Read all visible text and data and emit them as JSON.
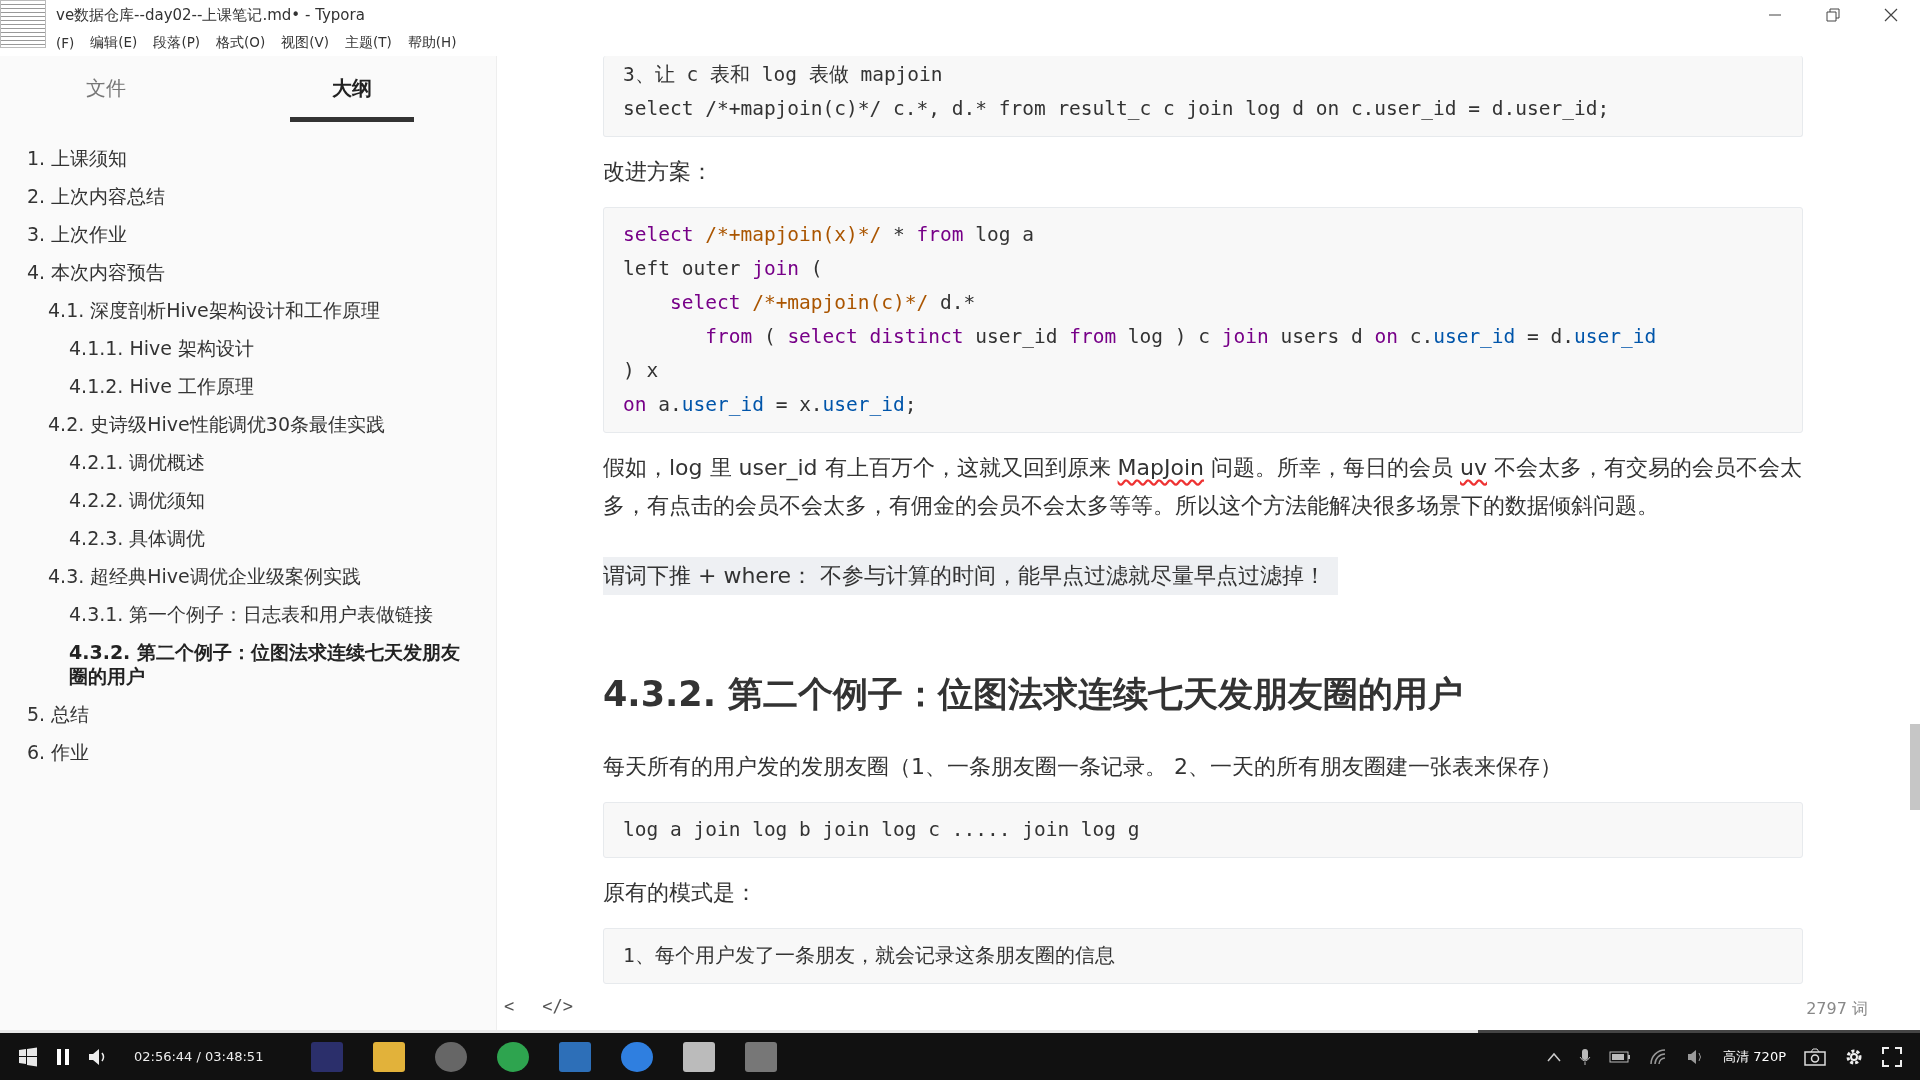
{
  "title_bar": {
    "title": "ve数据仓库--day02--上课笔记.md• - Typora"
  },
  "menu": [
    {
      "label": "(F)"
    },
    {
      "label": "编辑(E)"
    },
    {
      "label": "段落(P)"
    },
    {
      "label": "格式(O)"
    },
    {
      "label": "视图(V)"
    },
    {
      "label": "主题(T)"
    },
    {
      "label": "帮助(H)"
    }
  ],
  "sidebar": {
    "tabs": [
      {
        "label": "文件",
        "selected": false
      },
      {
        "label": "大纲",
        "selected": true
      }
    ],
    "outline": [
      {
        "label": "1. 上课须知",
        "selected": false
      },
      {
        "label": "2. 上次内容总结",
        "selected": false
      },
      {
        "label": "3. 上次作业",
        "selected": false
      },
      {
        "label": "4. 本次内容预告",
        "selected": false,
        "children": [
          {
            "label": "4.1. 深度剖析Hive架构设计和工作原理",
            "selected": false,
            "children": [
              {
                "label": "4.1.1. Hive 架构设计",
                "selected": false
              },
              {
                "label": "4.1.2. Hive 工作原理",
                "selected": false
              }
            ]
          },
          {
            "label": "4.2. 史诗级Hive性能调优30条最佳实践",
            "selected": false,
            "children": [
              {
                "label": "4.2.1. 调优概述",
                "selected": false
              },
              {
                "label": "4.2.2. 调优须知",
                "selected": false
              },
              {
                "label": "4.2.3. 具体调优",
                "selected": false
              }
            ]
          },
          {
            "label": "4.3. 超经典Hive调优企业级案例实践",
            "selected": false,
            "children": [
              {
                "label": "4.3.1. 第一个例子：日志表和用户表做链接",
                "selected": false
              },
              {
                "label": "4.3.2. 第二个例子：位图法求连续七天发朋友圈的用户",
                "selected": true
              }
            ]
          }
        ]
      },
      {
        "label": "5. 总结",
        "selected": false
      },
      {
        "label": "6. 作业",
        "selected": false
      }
    ],
    "footer": {
      "collapse_button": "<",
      "source_button": "</>"
    }
  },
  "document": [
    {
      "kind": "code",
      "lines": [
        [
          {
            "text": "3、让 c 表和 log 表做 mapjoin",
            "kind": "plain"
          }
        ],
        [
          {
            "text": "select /*+mapjoin(c)*/ c.*, d.* from result_c c join log d on c.user_id = d.user_id;",
            "kind": "plain"
          }
        ]
      ]
    },
    {
      "kind": "paragraph",
      "segments": [
        {
          "text": "改进方案：",
          "misspelled": false
        }
      ]
    },
    {
      "kind": "code",
      "lines": [
        [
          {
            "text": "select",
            "kind": "keyword"
          },
          {
            "text": " /*+mapjoin(x)*/",
            "kind": "comment"
          },
          {
            "text": " * ",
            "kind": "plain"
          },
          {
            "text": "from",
            "kind": "keyword"
          },
          {
            "text": " log a",
            "kind": "plain"
          }
        ],
        [
          {
            "text": "left outer ",
            "kind": "plain"
          },
          {
            "text": "join",
            "kind": "keyword"
          },
          {
            "text": " (",
            "kind": "plain"
          }
        ],
        [
          {
            "text": "    select",
            "kind": "keyword"
          },
          {
            "text": " /*+mapjoin(c)*/",
            "kind": "comment"
          },
          {
            "text": " d.*",
            "kind": "plain"
          }
        ],
        [
          {
            "text": "       from",
            "kind": "keyword"
          },
          {
            "text": " ( ",
            "kind": "plain"
          },
          {
            "text": "select distinct",
            "kind": "keyword"
          },
          {
            "text": " user_id ",
            "kind": "plain"
          },
          {
            "text": "from",
            "kind": "keyword"
          },
          {
            "text": " log ) c ",
            "kind": "plain"
          },
          {
            "text": "join",
            "kind": "keyword"
          },
          {
            "text": " users d ",
            "kind": "plain"
          },
          {
            "text": "on",
            "kind": "keyword"
          },
          {
            "text": " c.",
            "kind": "plain"
          },
          {
            "text": "user_id",
            "kind": "property"
          },
          {
            "text": " = d.",
            "kind": "plain"
          },
          {
            "text": "user_id",
            "kind": "property"
          }
        ],
        [
          {
            "text": ") x",
            "kind": "plain"
          }
        ],
        [
          {
            "text": "on",
            "kind": "keyword"
          },
          {
            "text": " a.",
            "kind": "plain"
          },
          {
            "text": "user_id",
            "kind": "property"
          },
          {
            "text": " = x.",
            "kind": "plain"
          },
          {
            "text": "user_id",
            "kind": "property"
          },
          {
            "text": ";",
            "kind": "plain"
          }
        ]
      ]
    },
    {
      "kind": "paragraph",
      "segments": [
        {
          "text": "假如，log 里 user_id 有上百万个，这就又回到原来 ",
          "misspelled": false
        },
        {
          "text": "MapJoin",
          "misspelled": true
        },
        {
          "text": " 问题。所幸，每日的会员 ",
          "misspelled": false
        },
        {
          "text": "uv",
          "misspelled": true
        },
        {
          "text": " 不会太多，有交易的会员不会太多，有点击的会员不会太多，有佣金的会员不会太多等等。所以这个方法能解决很多场景下的数据倾斜问题。",
          "misspelled": false
        }
      ]
    },
    {
      "kind": "paragraph",
      "highlighted": true,
      "segments": [
        {
          "text": "谓词下推 + where：  不参与计算的时间，能早点过滤就尽量早点过滤掉！",
          "misspelled": false
        }
      ]
    },
    {
      "kind": "heading",
      "text": "4.3.2. 第二个例子：位图法求连续七天发朋友圈的用户"
    },
    {
      "kind": "paragraph",
      "segments": [
        {
          "text": "每天所有的用户发的发朋友圈（1、一条朋友圈一条记录。 2、一天的所有朋友圈建一张表来保存）",
          "misspelled": false
        }
      ]
    },
    {
      "kind": "code",
      "lines": [
        [
          {
            "text": "log a join log b join log c ..... join log g",
            "kind": "plain"
          }
        ]
      ]
    },
    {
      "kind": "paragraph",
      "segments": [
        {
          "text": "原有的模式是：",
          "misspelled": false
        }
      ]
    },
    {
      "kind": "code",
      "lines": [
        [
          {
            "text": "1、每个用户发了一条朋友，就会记录这条朋友圈的信息",
            "kind": "plain"
          }
        ]
      ]
    }
  ],
  "word_count": "2797 词",
  "player": {
    "time": "02:56:44 / 03:48:51",
    "progress": {
      "level": 0.77
    },
    "quality": "高清 720P"
  }
}
